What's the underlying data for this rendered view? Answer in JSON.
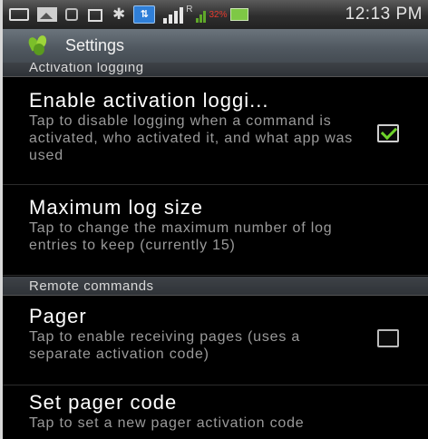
{
  "status_bar": {
    "time": "12:13 PM",
    "battery_percent": "32%",
    "network_indicator": "R",
    "icons": [
      "notification-icon",
      "gallery-icon",
      "message-icon",
      "usb-icon",
      "bluetooth-icon",
      "data-icon",
      "signal-icon",
      "battery-icon"
    ]
  },
  "header": {
    "title": "Settings",
    "app_icon": "clover-app-icon"
  },
  "sections": {
    "activation_logging": {
      "header": "Activation logging",
      "enable_logging": {
        "title": "Enable activation loggi...",
        "summary": "Tap to disable logging when a command is activated, who activated it, and what app was used",
        "checked": true
      },
      "max_log_size": {
        "title": "Maximum log size",
        "summary": "Tap to change the maximum number of log entries to keep (currently 15)"
      }
    },
    "remote_commands": {
      "header": "Remote commands",
      "pager": {
        "title": "Pager",
        "summary": "Tap to enable receiving pages (uses a separate activation code)",
        "checked": false
      },
      "set_pager_code": {
        "title": "Set pager code",
        "summary": "Tap to set a new pager activation code"
      }
    }
  },
  "colors": {
    "check_mark": "#6fd42a",
    "summary_text": "#9a9a9a",
    "status_red": "#e63a2e",
    "battery_green": "#7ec845"
  }
}
